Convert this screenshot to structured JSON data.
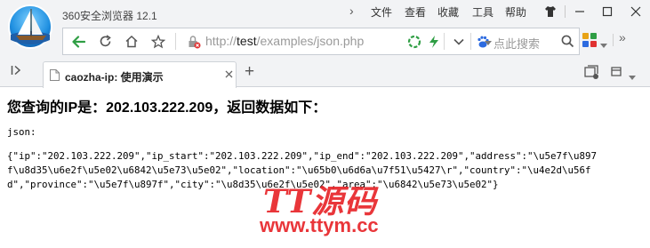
{
  "window": {
    "app_title": "360安全浏览器 12.1",
    "menu": [
      "文件",
      "查看",
      "收藏",
      "工具",
      "帮助"
    ]
  },
  "navbar": {
    "url_prefix": "http://",
    "url_host": "test",
    "url_path": "/examples/json.php",
    "search_placeholder": "点此搜索"
  },
  "tabs": [
    {
      "title": "caozha-ip: 使用演示"
    }
  ],
  "page": {
    "heading": "您查询的IP是：202.103.222.209，返回数据如下：",
    "json_label": "json:",
    "json_lines": [
      "{\"ip\":\"202.103.222.209\",\"ip_start\":\"202.103.222.209\",\"ip_end\":\"202.103.222.209\",\"address\":\"\\u5e7f\\u897",
      "f\\u8d35\\u6e2f\\u5e02\\u6842\\u5e73\\u5e02\",\"location\":\"\\u65b0\\u6d6a\\u7f51\\u5427\\r\",\"country\":\"\\u4e2d\\u56f",
      "d\",\"province\":\"\\u5e7f\\u897f\",\"city\":\"\\u8d35\\u6e2f\\u5e02\",\"area\":\"\\u6842\\u5e73\\u5e02\"}"
    ]
  },
  "watermark": {
    "title": "TT源码",
    "url": "www.ttym.cc"
  },
  "colors": {
    "chrome_bg": "#f2f3f5",
    "accent_green": "#2f9e44",
    "watermark_red": "#e8262a"
  }
}
